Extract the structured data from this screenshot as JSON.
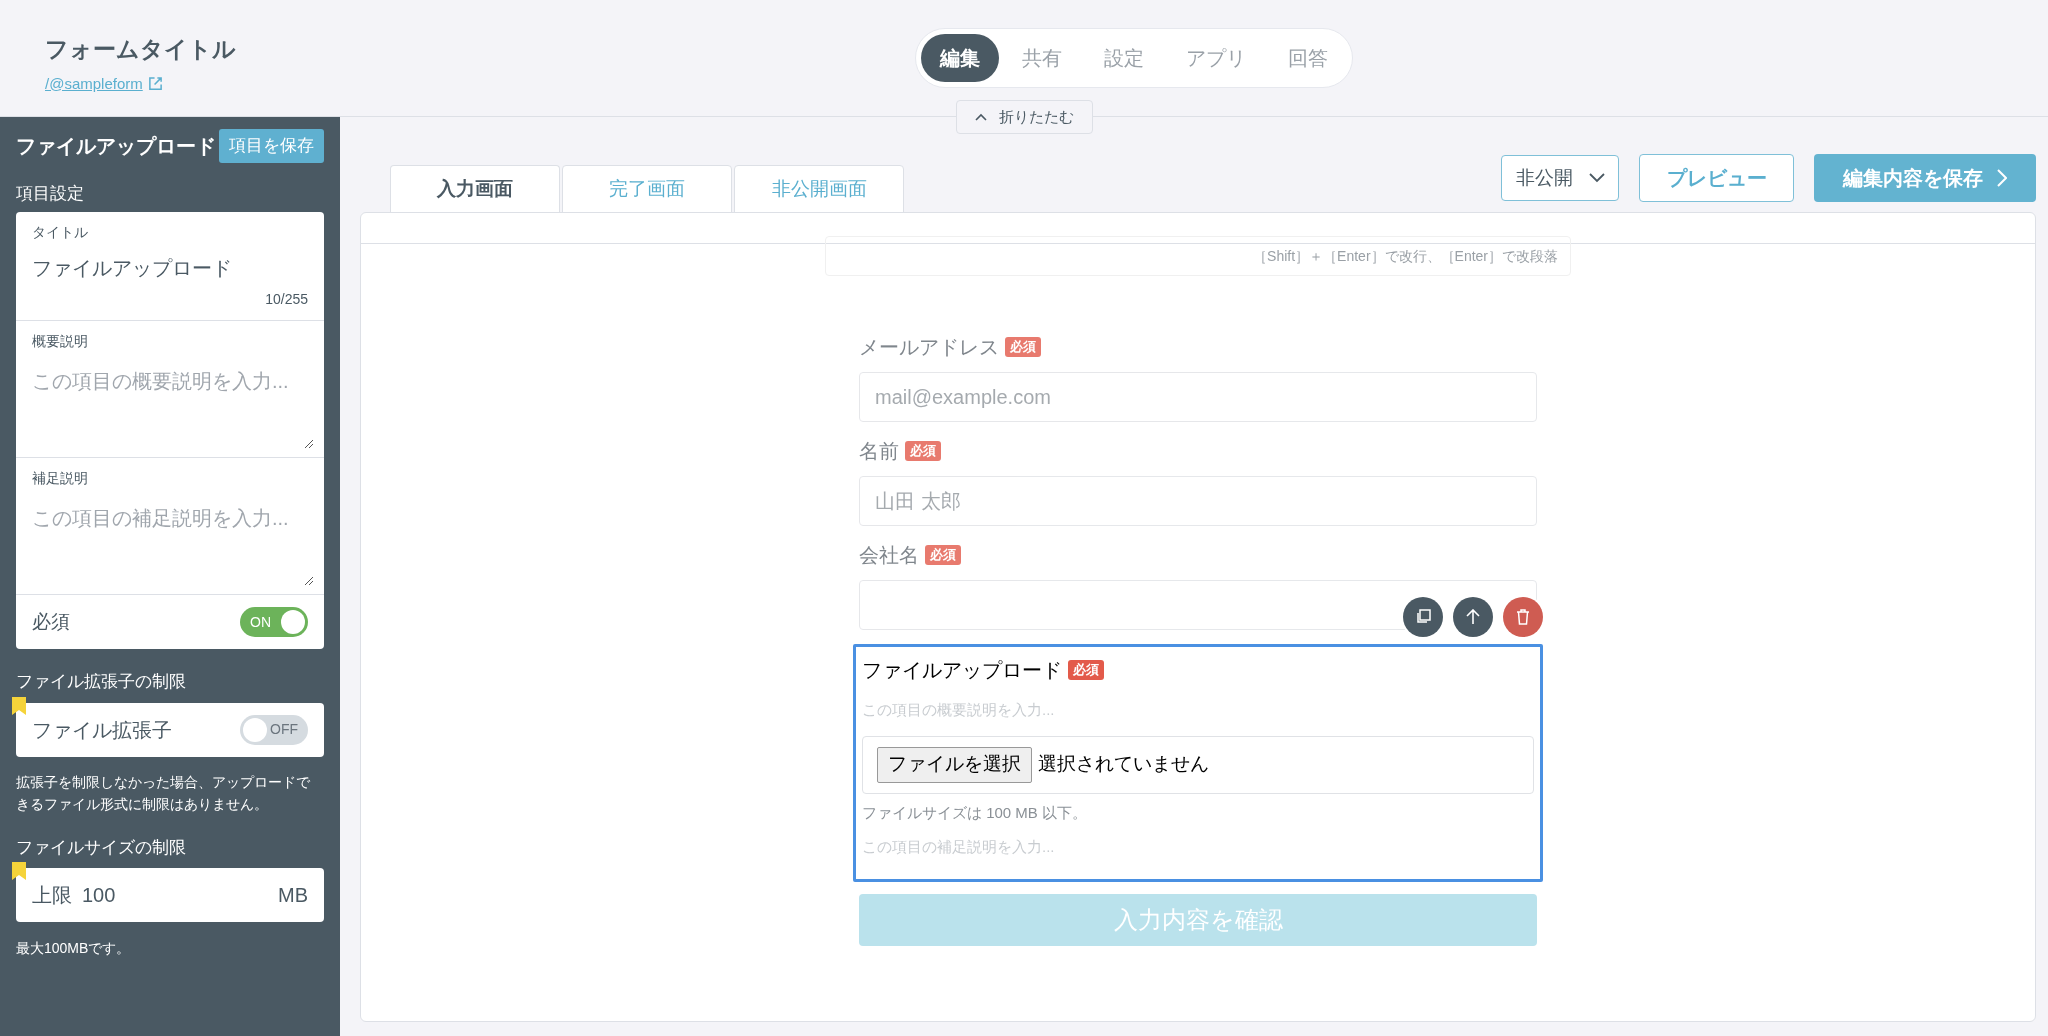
{
  "header": {
    "title": "フォームタイトル",
    "link": "/@sampleform"
  },
  "nav": [
    {
      "label": "編集",
      "selected": true
    },
    {
      "label": "共有",
      "selected": false
    },
    {
      "label": "設定",
      "selected": false
    },
    {
      "label": "アプリ",
      "selected": false
    },
    {
      "label": "回答",
      "selected": false
    }
  ],
  "collapse_button": "折りたたむ",
  "sidebar": {
    "title": "ファイルアップロード",
    "save_button": "項目を保存",
    "section_label": "項目設定",
    "title_field": {
      "label": "タイトル",
      "value": "ファイルアップロード",
      "counter": "10/255"
    },
    "summary_field": {
      "label": "概要説明",
      "placeholder": "この項目の概要説明を入力..."
    },
    "supplement_field": {
      "label": "補足説明",
      "placeholder": "この項目の補足説明を入力..."
    },
    "required": {
      "label": "必須",
      "on": true,
      "toggle_label": "ON"
    },
    "extension": {
      "heading": "ファイル拡張子の制限",
      "label": "ファイル拡張子",
      "on": false,
      "toggle_label": "OFF",
      "note": "拡張子を制限しなかった場合、アップロードできるファイル形式に制限はありません。"
    },
    "size": {
      "heading": "ファイルサイズの制限",
      "prefix": "上限",
      "value": "100",
      "unit": "MB",
      "note": "最大100MBです。"
    }
  },
  "tabs": [
    {
      "label": "入力画面",
      "selected": true
    },
    {
      "label": "完了画面",
      "selected": false
    },
    {
      "label": "非公開画面",
      "selected": false
    }
  ],
  "visibility_select": "非公開",
  "preview_button": "プレビュー",
  "save_button": "編集内容を保存",
  "form": {
    "toolbar_hint": "［Shift］＋［Enter］で改行、［Enter］で改段落",
    "fields": [
      {
        "kind": "text",
        "label": "メールアドレス",
        "badge": "必須",
        "placeholder": "mail@example.com",
        "selected": false
      },
      {
        "kind": "text",
        "label": "名前",
        "badge": "必須",
        "placeholder": "山田 太郎",
        "selected": false
      },
      {
        "kind": "text",
        "label": "会社名",
        "badge": "必須",
        "selected": false
      },
      {
        "kind": "file",
        "label": "ファイルアップロード",
        "badge": "必須",
        "summary_placeholder": "この項目の概要説明を入力...",
        "file_button": "ファイルを選択",
        "file_status": "選択されていません",
        "size_note": "ファイルサイズは 100 MB 以下。",
        "supplement_placeholder": "この項目の補足説明を入力...",
        "selected": true
      }
    ],
    "submit_button": "入力内容を確認"
  }
}
